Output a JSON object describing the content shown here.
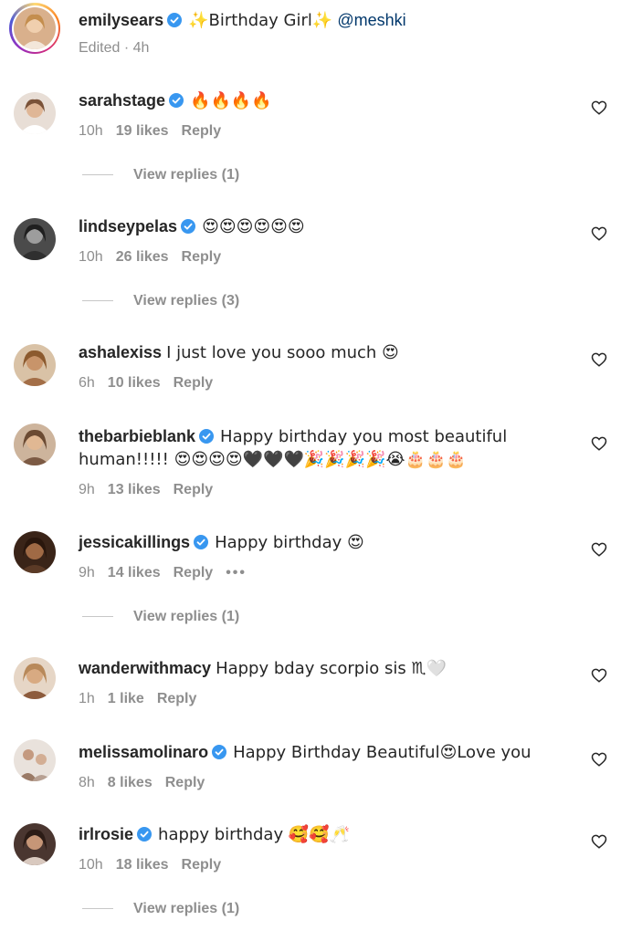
{
  "caption": {
    "username": "emilysears",
    "text": "✨Birthday Girl✨",
    "mention": "@meshki",
    "meta": "Edited · 4h"
  },
  "comments": [
    {
      "username": "sarahstage",
      "verified": true,
      "text": "🔥🔥🔥🔥",
      "time": "10h",
      "likes": "19 likes",
      "reply": "Reply",
      "view_replies": "View replies (1)",
      "avatar_color": "#c9a38a"
    },
    {
      "username": "lindseypelas",
      "verified": true,
      "text": "😍😍😍😍😍😍",
      "time": "10h",
      "likes": "26 likes",
      "reply": "Reply",
      "view_replies": "View replies (3)",
      "avatar_color": "#6b6b6b"
    },
    {
      "username": "ashalexiss",
      "verified": false,
      "text": "I just love you sooo much 😍",
      "time": "6h",
      "likes": "10 likes",
      "reply": "Reply",
      "avatar_color": "#b88a5e"
    },
    {
      "username": "thebarbieblank",
      "verified": true,
      "text": "Happy birthday you most beautiful human!!!!! 😍😍😍😍🖤🖤🖤🎉🎉🎉🎉😭🎂🎂🎂",
      "time": "9h",
      "likes": "13 likes",
      "reply": "Reply",
      "avatar_color": "#a37d62"
    },
    {
      "username": "jessicakillings",
      "verified": true,
      "text": "Happy birthday 😍",
      "time": "9h",
      "likes": "14 likes",
      "reply": "Reply",
      "more": "•••",
      "view_replies": "View replies (1)",
      "avatar_color": "#8a5a3c"
    },
    {
      "username": "wanderwithmacy",
      "verified": false,
      "text": "Happy bday scorpio sis ♏🤍",
      "time": "1h",
      "likes": "1 like",
      "reply": "Reply",
      "avatar_color": "#c7a48a"
    },
    {
      "username": "melissamolinaro",
      "verified": true,
      "text": "Happy Birthday Beautiful😍Love you",
      "time": "8h",
      "likes": "8 likes",
      "reply": "Reply",
      "avatar_color": "#b59a8c"
    },
    {
      "username": "irlrosie",
      "verified": true,
      "text": "happy birthday 🥰🥰🥂",
      "time": "10h",
      "likes": "18 likes",
      "reply": "Reply",
      "view_replies": "View replies (1)",
      "avatar_color": "#6e5448"
    }
  ],
  "colors": {
    "verified_blue": "#3897f0",
    "secondary_text": "#8e8e8e",
    "mention": "#00376b"
  }
}
